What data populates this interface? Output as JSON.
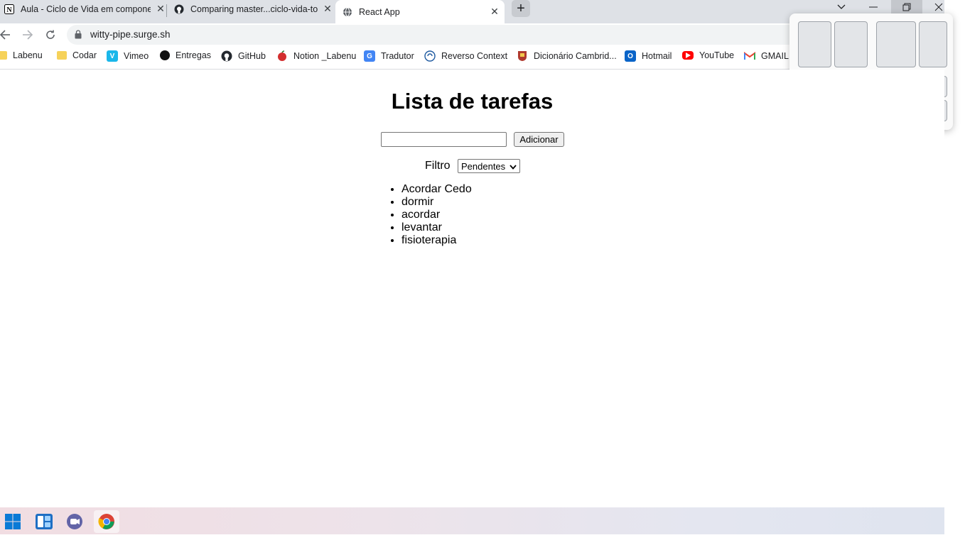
{
  "browser": {
    "tabs": [
      {
        "title": "Aula - Ciclo de Vida em componentes",
        "favicon": "notion-icon"
      },
      {
        "title": "Comparing master...ciclo-vida-torre",
        "favicon": "github-icon"
      },
      {
        "title": "React App",
        "favicon": "globe-icon"
      }
    ],
    "new_tab_label": "+",
    "url": "witty-pipe.surge.sh",
    "bookmarks": [
      {
        "label": "Labenu",
        "icon": "folder-icon"
      },
      {
        "label": "Codar",
        "icon": "folder-icon"
      },
      {
        "label": "Vimeo",
        "icon": "vimeo-icon"
      },
      {
        "label": "Entregas",
        "icon": "circle-icon"
      },
      {
        "label": "GitHub",
        "icon": "github-icon"
      },
      {
        "label": "Notion _Labenu",
        "icon": "apple-icon"
      },
      {
        "label": "Tradutor",
        "icon": "translate-icon"
      },
      {
        "label": "Reverso Context",
        "icon": "reverso-icon"
      },
      {
        "label": "Dicionário Cambrid...",
        "icon": "cambridge-icon"
      },
      {
        "label": "Hotmail",
        "icon": "outlook-icon"
      },
      {
        "label": "YouTube",
        "icon": "youtube-icon"
      },
      {
        "label": "GMAIL",
        "icon": "gmail-icon"
      }
    ]
  },
  "app": {
    "title": "Lista de tarefas",
    "input_value": "",
    "add_button": "Adicionar",
    "filter_label": "Filtro",
    "filter_selected": "Pendentes",
    "tasks": [
      "Acordar Cedo",
      "dormir",
      "acordar",
      "levantar",
      "fisioterapia"
    ]
  },
  "taskbar": {
    "items": [
      "windows-start-icon",
      "widgets-icon",
      "teams-chat-icon",
      "chrome-icon"
    ]
  }
}
